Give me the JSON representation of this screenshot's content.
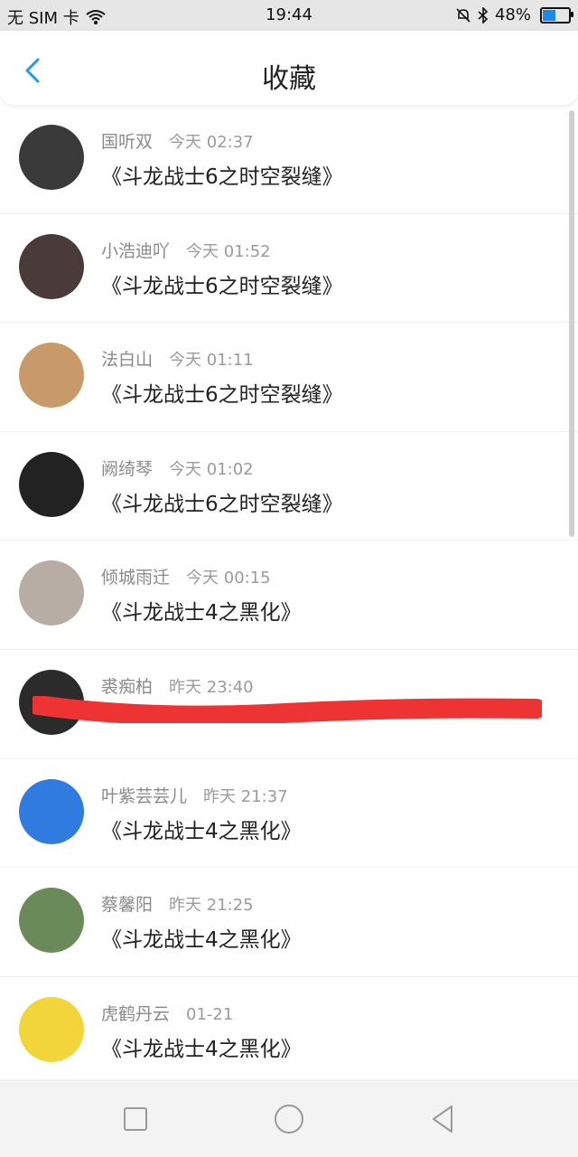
{
  "status_bar": {
    "carrier": "无 SIM 卡",
    "time": "19:44",
    "battery": "48%",
    "battery_level": 0.48
  },
  "header": {
    "title": "收藏",
    "back_icon": "chevron-left-icon",
    "accent": "#2196f3"
  },
  "favorites": [
    {
      "user": "国听双",
      "time": "今天 02:37",
      "work": "《斗龙战士6之时空裂缝》",
      "avatar_color": "#3a3a3a"
    },
    {
      "user": "小浩迪吖",
      "time": "今天 01:52",
      "work": "《斗龙战士6之时空裂缝》",
      "avatar_color": "#4a3a3a"
    },
    {
      "user": "法白山",
      "time": "今天 01:11",
      "work": "《斗龙战士6之时空裂缝》",
      "avatar_color": "#c89a6a"
    },
    {
      "user": "阙绮琴",
      "time": "今天 01:02",
      "work": "《斗龙战士6之时空裂缝》",
      "avatar_color": "#222222"
    },
    {
      "user": "倾城雨迁",
      "time": "今天 00:15",
      "work": "《斗龙战士4之黑化》",
      "avatar_color": "#b7ada5"
    },
    {
      "user": "裘痴柏",
      "time": "昨天 23:40",
      "work": "",
      "avatar_color": "#2b2b2b"
    },
    {
      "user": "叶紫芸芸儿",
      "time": "昨天 21:37",
      "work": "《斗龙战士4之黑化》",
      "avatar_color": "#2f7be0"
    },
    {
      "user": "蔡馨阳",
      "time": "昨天 21:25",
      "work": "《斗龙战士4之黑化》",
      "avatar_color": "#6b8a5a"
    },
    {
      "user": "虎鹤丹云",
      "time": "01-21",
      "work": "《斗龙战士4之黑化》",
      "avatar_color": "#f1d53a"
    }
  ],
  "redaction_color": "#ee3333",
  "nav": {
    "buttons": [
      "recent-apps-icon",
      "home-icon",
      "back-icon"
    ]
  }
}
